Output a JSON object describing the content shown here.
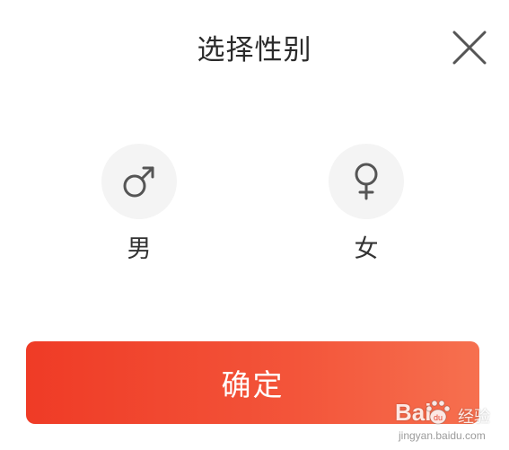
{
  "dialog": {
    "title": "选择性别",
    "close_icon": "close-icon"
  },
  "options": [
    {
      "label": "男",
      "icon": "male-symbol-icon"
    },
    {
      "label": "女",
      "icon": "female-symbol-icon"
    }
  ],
  "confirm": {
    "label": "确定"
  },
  "watermark": {
    "brand_left": "Bai",
    "brand_right": "du",
    "cn": "经验",
    "url": "jingyan.baidu.com"
  },
  "colors": {
    "accent_start": "#ef3b26",
    "accent_end": "#f6704f",
    "icon_gray": "#555555",
    "circle_bg": "#f4f4f4"
  }
}
